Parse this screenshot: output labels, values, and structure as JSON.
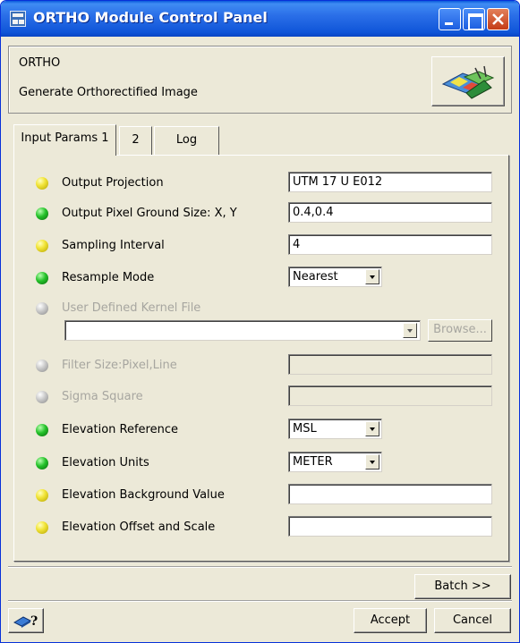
{
  "window": {
    "title": "ORTHO Module Control Panel",
    "controls": [
      "minimize",
      "maximize",
      "close"
    ]
  },
  "header": {
    "module_name": "ORTHO",
    "description": "Generate Orthorectified Image",
    "icon": "ortho-module-icon"
  },
  "tabs": [
    {
      "label": "Input Params 1",
      "selected": true
    },
    {
      "label": "2",
      "selected": false
    },
    {
      "label": "Log",
      "selected": false
    }
  ],
  "params": {
    "output_projection": {
      "label": "Output Projection",
      "value": "UTM 17 U E012",
      "status": "yellow"
    },
    "pixel_size": {
      "label": "Output Pixel Ground Size: X, Y",
      "value": "0.4,0.4",
      "status": "green"
    },
    "sampling_interval": {
      "label": "Sampling Interval",
      "value": "4",
      "status": "yellow"
    },
    "resample_mode": {
      "label": "Resample Mode",
      "value": "Nearest",
      "status": "green"
    },
    "kernel_file": {
      "label": "User Defined Kernel File",
      "value": "",
      "status": "gray",
      "browse_label": "Browse..."
    },
    "filter_size": {
      "label": "Filter Size:Pixel,Line",
      "value": "",
      "status": "gray"
    },
    "sigma_square": {
      "label": "Sigma Square",
      "value": "",
      "status": "gray"
    },
    "elevation_reference": {
      "label": "Elevation Reference",
      "value": "MSL",
      "status": "green"
    },
    "elevation_units": {
      "label": "Elevation Units",
      "value": "METER",
      "status": "green"
    },
    "elevation_background": {
      "label": "Elevation Background Value",
      "value": "",
      "status": "yellow"
    },
    "elevation_offset": {
      "label": "Elevation Offset and Scale",
      "value": "",
      "status": "yellow"
    }
  },
  "buttons": {
    "batch": "Batch >>",
    "accept": "Accept",
    "cancel": "Cancel",
    "help_icon": "help-icon"
  },
  "colors": {
    "title_bar": "#2b6fe8",
    "window_bg": "#ece9d8",
    "status_yellow": "#f2e53a",
    "status_green": "#25c22a",
    "status_gray": "#c8c8c8"
  }
}
